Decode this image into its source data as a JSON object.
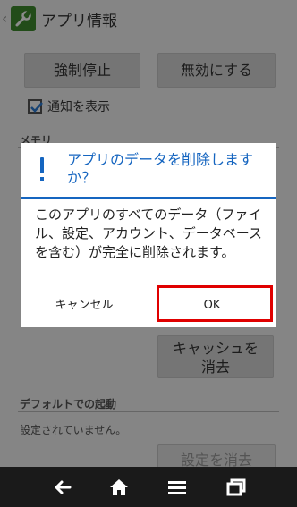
{
  "header": {
    "title": "アプリ情報"
  },
  "buttons": {
    "force_stop": "強制停止",
    "disable": "無効にする",
    "clear_cache_line1": "キャッシュを",
    "clear_cache_line2": "消去",
    "clear_defaults": "設定を消去"
  },
  "notify": {
    "label": "通知を表示",
    "checked": true
  },
  "sections": {
    "memory": "メモリ",
    "default_launch": "デフォルトでの起動",
    "not_set": "設定されていません。"
  },
  "dialog": {
    "title": "アプリのデータを削除しますか？",
    "message": "このアプリのすべてのデータ（ファイル、設定、アカウント、データベースを含む）が完全に削除されます。",
    "cancel": "キャンセル",
    "ok": "OK"
  },
  "colors": {
    "accent": "#1565c0",
    "highlight": "#e00000",
    "navbar": "#1a1a1a"
  },
  "icons": [
    "wrench-icon",
    "exclamation-icon",
    "back-icon",
    "home-icon",
    "menu-icon",
    "recent-apps-icon"
  ]
}
